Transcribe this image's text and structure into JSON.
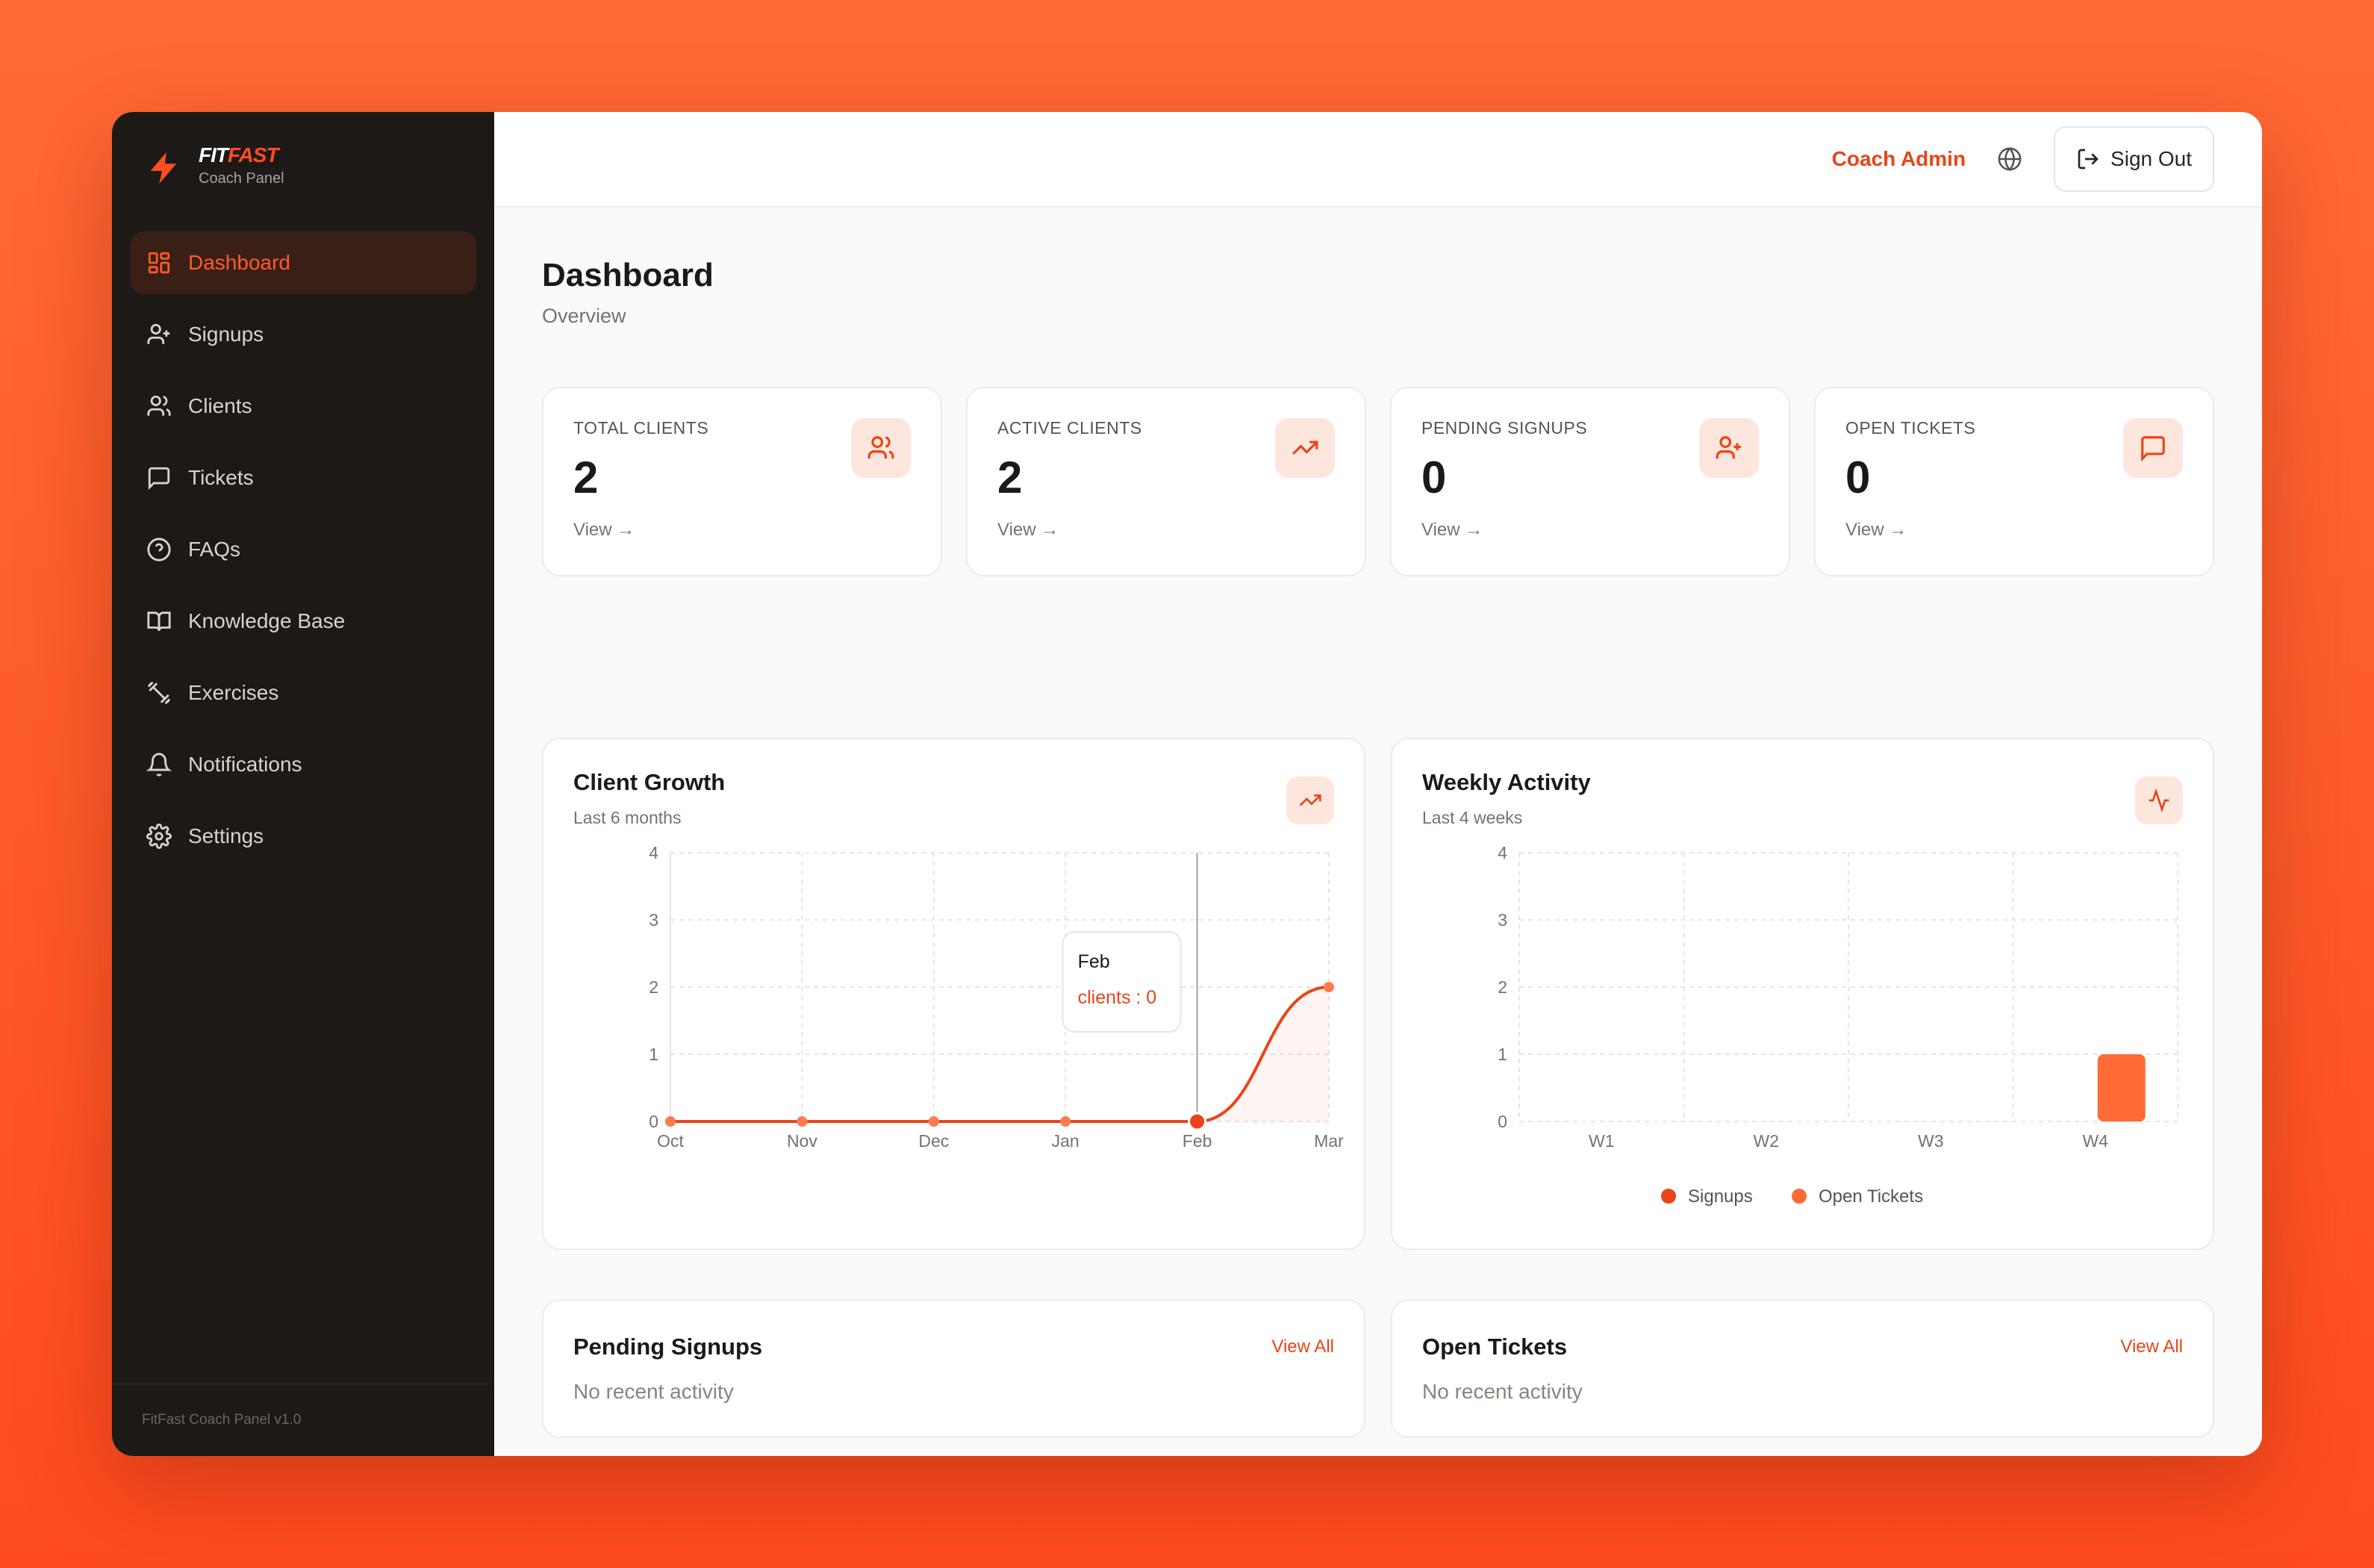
{
  "brand": {
    "name_fit": "FIT",
    "name_fast": "FAST",
    "subtitle": "Coach Panel"
  },
  "sidebar": {
    "items": [
      {
        "label": "Dashboard",
        "icon": "grid-icon",
        "active": true
      },
      {
        "label": "Signups",
        "icon": "user-plus-icon"
      },
      {
        "label": "Clients",
        "icon": "users-icon"
      },
      {
        "label": "Tickets",
        "icon": "message-square-icon"
      },
      {
        "label": "FAQs",
        "icon": "help-circle-icon"
      },
      {
        "label": "Knowledge Base",
        "icon": "book-open-icon"
      },
      {
        "label": "Exercises",
        "icon": "dumbbell-icon"
      },
      {
        "label": "Notifications",
        "icon": "bell-icon"
      },
      {
        "label": "Settings",
        "icon": "gear-icon"
      }
    ],
    "footer": "FitFast Coach Panel v1.0"
  },
  "header": {
    "user": "Coach Admin",
    "signout_label": "Sign Out"
  },
  "page": {
    "title": "Dashboard",
    "subtitle": "Overview"
  },
  "stats": [
    {
      "label": "TOTAL CLIENTS",
      "value": "2",
      "link": "View →",
      "icon": "users-icon"
    },
    {
      "label": "ACTIVE CLIENTS",
      "value": "2",
      "link": "View →",
      "icon": "trending-up-icon"
    },
    {
      "label": "PENDING SIGNUPS",
      "value": "0",
      "link": "View →",
      "icon": "user-plus-icon"
    },
    {
      "label": "OPEN TICKETS",
      "value": "0",
      "link": "View →",
      "icon": "message-square-icon"
    }
  ],
  "panels": {
    "growth": {
      "title": "Client Growth",
      "subtitle": "Last 6 months"
    },
    "weekly": {
      "title": "Weekly Activity",
      "subtitle": "Last 4 weeks"
    }
  },
  "chart_data": [
    {
      "type": "line",
      "x": [
        "Oct",
        "Nov",
        "Dec",
        "Jan",
        "Feb",
        "Mar"
      ],
      "series": [
        {
          "name": "clients",
          "values": [
            0,
            0,
            0,
            0,
            0,
            2
          ]
        }
      ],
      "ylim": [
        0,
        4
      ],
      "yticks": [
        0,
        1,
        2,
        3,
        4
      ],
      "grid": true,
      "tooltip": {
        "x": "Feb",
        "label": "clients : 0"
      },
      "color": "#ea4418"
    },
    {
      "type": "bar",
      "categories": [
        "W1",
        "W2",
        "W3",
        "W4"
      ],
      "series": [
        {
          "name": "Signups",
          "values": [
            0,
            0,
            0,
            0
          ],
          "color": "#ea4418"
        },
        {
          "name": "Open Tickets",
          "values": [
            0,
            0,
            0,
            1
          ],
          "color": "#ff6a35"
        }
      ],
      "ylim": [
        0,
        4
      ],
      "yticks": [
        0,
        1,
        2,
        3,
        4
      ],
      "grid": true,
      "legend": "bottom"
    }
  ],
  "bottom": {
    "pending": {
      "title": "Pending Signups",
      "link": "View All",
      "empty": "No recent activity"
    },
    "tickets": {
      "title": "Open Tickets",
      "link": "View All",
      "empty": "No recent activity"
    }
  },
  "colors": {
    "accent": "#ea4418",
    "sidebar_bg": "#1c1917",
    "icon_bg": "#fde7dd"
  }
}
